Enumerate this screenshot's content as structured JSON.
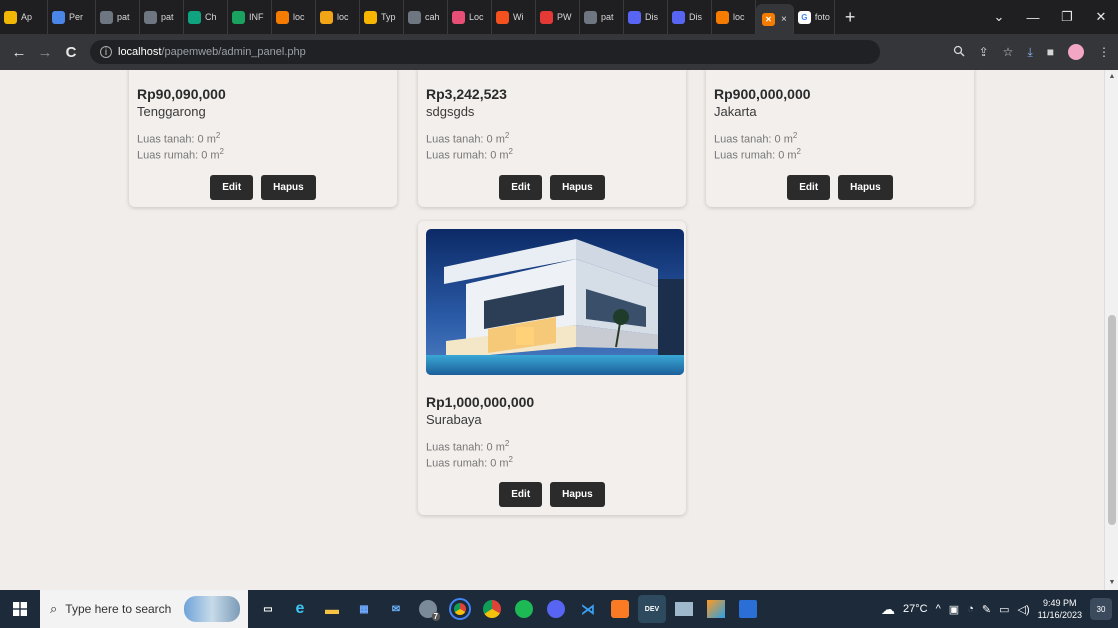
{
  "browser": {
    "tabs": [
      {
        "label": "Ap",
        "color": "#f2b705"
      },
      {
        "label": "Per",
        "color": "#4a86e8"
      },
      {
        "label": "pat",
        "color": "#6e7681"
      },
      {
        "label": "pat",
        "color": "#6e7681"
      },
      {
        "label": "Ch",
        "color": "#10a37f"
      },
      {
        "label": "INF",
        "color": "#1aa260"
      },
      {
        "label": "loc",
        "color": "#f57c00"
      },
      {
        "label": "loc",
        "color": "#f2a516"
      },
      {
        "label": "Typ",
        "color": "#f7b500"
      },
      {
        "label": "cah",
        "color": "#6e7681"
      },
      {
        "label": "Loc",
        "color": "#e94e77"
      },
      {
        "label": "Wi",
        "color": "#f4511e"
      },
      {
        "label": "PW",
        "color": "#e53935"
      },
      {
        "label": "pat",
        "color": "#6e7681"
      },
      {
        "label": "Dis",
        "color": "#5865f2"
      },
      {
        "label": "Dis",
        "color": "#5865f2"
      },
      {
        "label": "loc",
        "color": "#f57c00"
      }
    ],
    "active_tab": {
      "close": "×"
    },
    "extra_tab": {
      "label": "foto",
      "color": "#4285f4"
    },
    "new_tab": "+",
    "window_controls": [
      "⌄",
      "—",
      "❐",
      "✕"
    ],
    "url_host": "localhost",
    "url_path": "/papemweb/admin_panel.php"
  },
  "listings": [
    {
      "price": "Rp90,090,000",
      "city": "Tenggarong",
      "luas_tanah": "Luas tanah: 0 m",
      "luas_rumah": "Luas rumah: 0 m",
      "unit_sup": "2",
      "edit": "Edit",
      "hapus": "Hapus"
    },
    {
      "price": "Rp3,242,523",
      "city": "sdgsgds",
      "luas_tanah": "Luas tanah: 0 m",
      "luas_rumah": "Luas rumah: 0 m",
      "unit_sup": "2",
      "edit": "Edit",
      "hapus": "Hapus"
    },
    {
      "price": "Rp900,000,000",
      "city": "Jakarta",
      "luas_tanah": "Luas tanah: 0 m",
      "luas_rumah": "Luas rumah: 0 m",
      "unit_sup": "2",
      "edit": "Edit",
      "hapus": "Hapus"
    },
    {
      "price": "Rp1,000,000,000",
      "city": "Surabaya",
      "luas_tanah": "Luas tanah: 0 m",
      "luas_rumah": "Luas rumah: 0 m",
      "unit_sup": "2",
      "edit": "Edit",
      "hapus": "Hapus"
    }
  ],
  "taskbar": {
    "search_placeholder": "Type here to search",
    "badge_count": "7",
    "weather": "27°C",
    "time": "9:49 PM",
    "date": "11/16/2023",
    "notifications": "30"
  }
}
